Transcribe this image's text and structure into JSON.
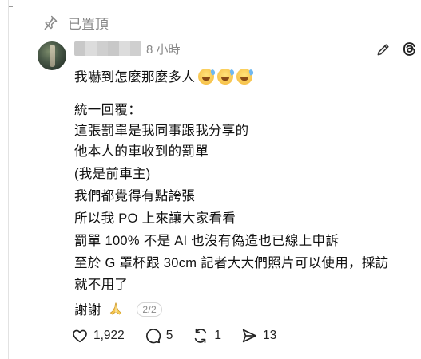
{
  "pinned": {
    "label": "已置頂",
    "icon": "pin-icon"
  },
  "post": {
    "author_name": "",
    "time": "8 小時",
    "first_line": "我嚇到怎麼那麼多人",
    "first_line_emojis": [
      "grinning-sweat-emoji",
      "grinning-sweat-emoji",
      "grinning-sweat-emoji"
    ],
    "lines": [
      "統一回覆：",
      "這張罰單是我同事跟我分享的",
      "他本人的車收到的罰單",
      "(我是前車主)",
      "我們都覺得有點誇張",
      "所以我 PO 上來讓大家看看",
      "罰單 100% 不是 AI 也沒有偽造也已線上申訴",
      "至於 G 罩杯跟 30cm 記者大大們照片可以使用，採訪",
      "就不用了"
    ],
    "thanks": "謝謝",
    "thanks_emoji": "folded-hands-emoji",
    "page_indicator": "2/2"
  },
  "actions": {
    "likes": "1,922",
    "comments": "5",
    "reposts": "1",
    "shares": "13"
  },
  "header_icons": [
    "edit-icon",
    "threads-icon"
  ]
}
